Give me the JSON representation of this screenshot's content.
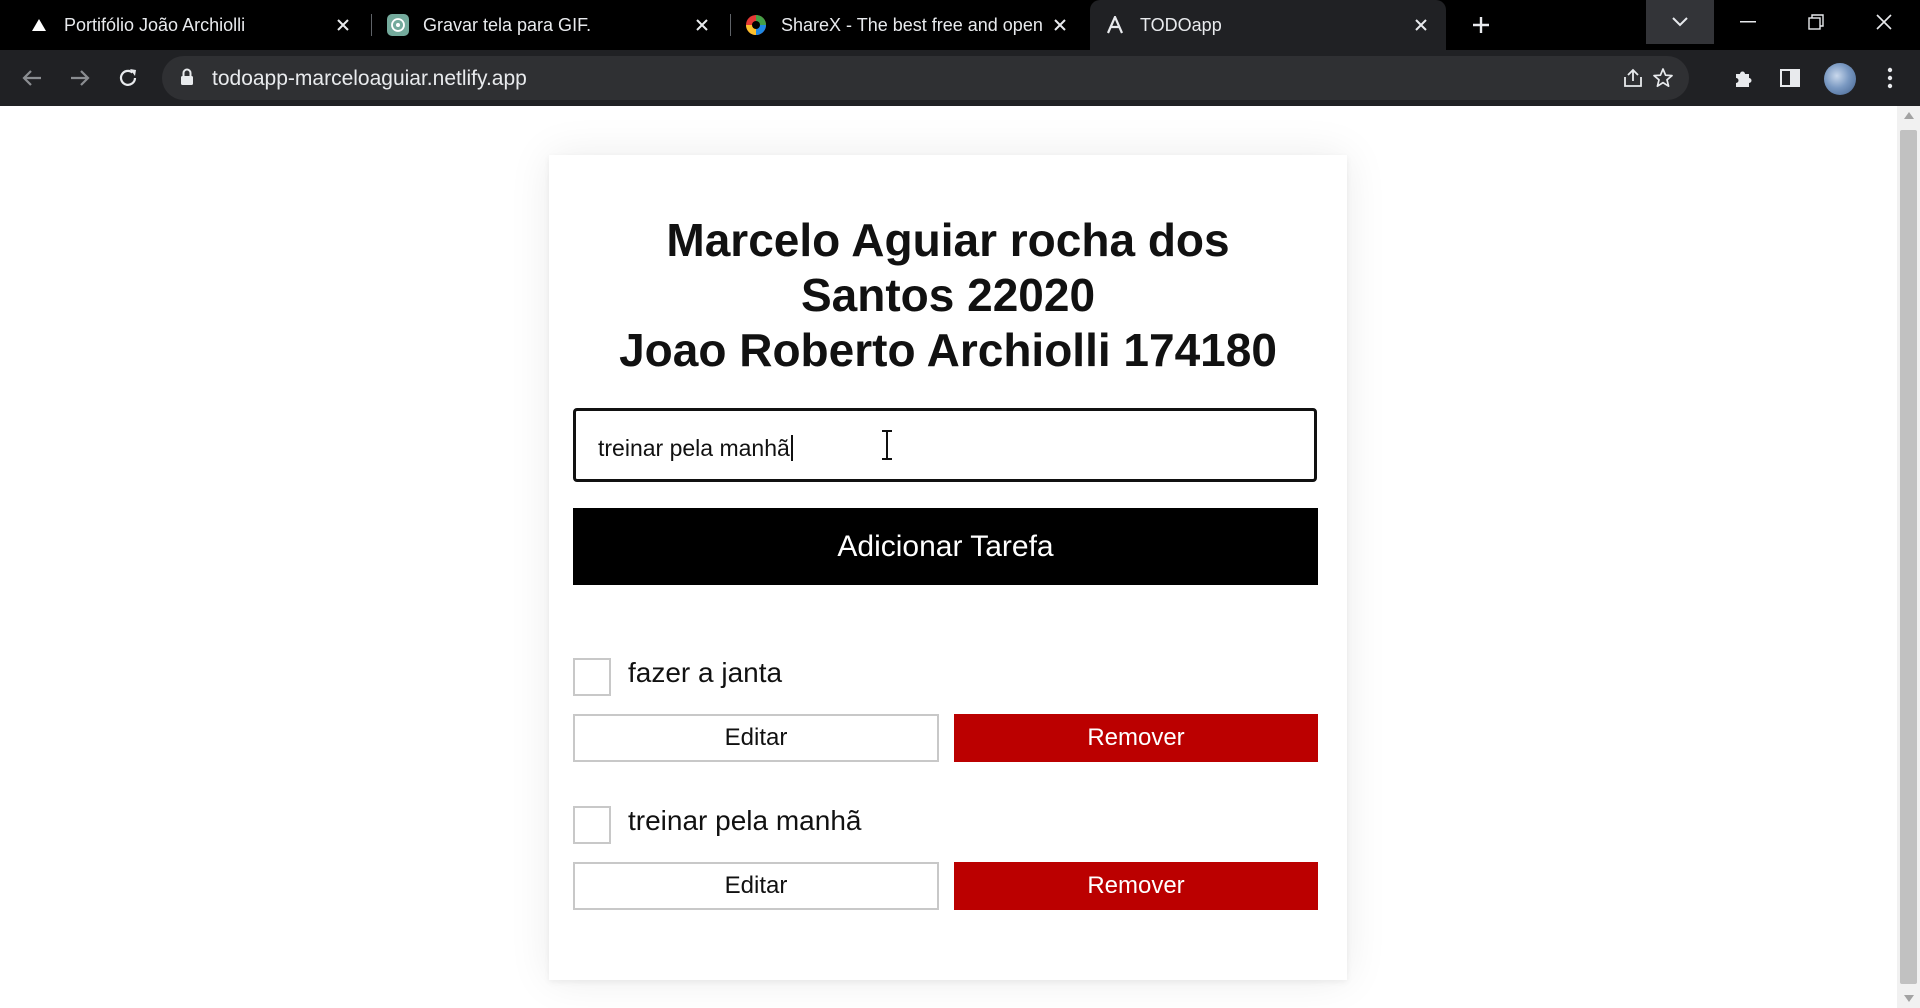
{
  "browser": {
    "tabs": [
      {
        "title": "Portifólio João Archiolli",
        "icon": "triangle-logo-icon"
      },
      {
        "title": "Gravar tela para GIF.",
        "icon": "chatgpt-logo-icon"
      },
      {
        "title": "ShareX - The best free and open",
        "icon": "sharex-logo-icon"
      },
      {
        "title": "TODOapp",
        "icon": "a-logo-icon",
        "active": true
      }
    ],
    "url": "todoapp-marceloaguiar.netlify.app"
  },
  "app": {
    "heading_line1": "Marcelo Aguiar rocha dos",
    "heading_line2": "Santos 22020",
    "heading_line3": "Joao Roberto Archiolli 174180",
    "input_value": "treinar pela manhã",
    "add_button": "Adicionar Tarefa",
    "tasks": [
      {
        "text": "fazer a janta",
        "checked": false,
        "edit": "Editar",
        "remove": "Remover"
      },
      {
        "text": "treinar pela manhã",
        "checked": false,
        "edit": "Editar",
        "remove": "Remover"
      }
    ]
  },
  "colors": {
    "remove_button": "#bb0000",
    "add_button": "#000000",
    "tab_strip": "#000000",
    "toolbar": "#202124"
  }
}
